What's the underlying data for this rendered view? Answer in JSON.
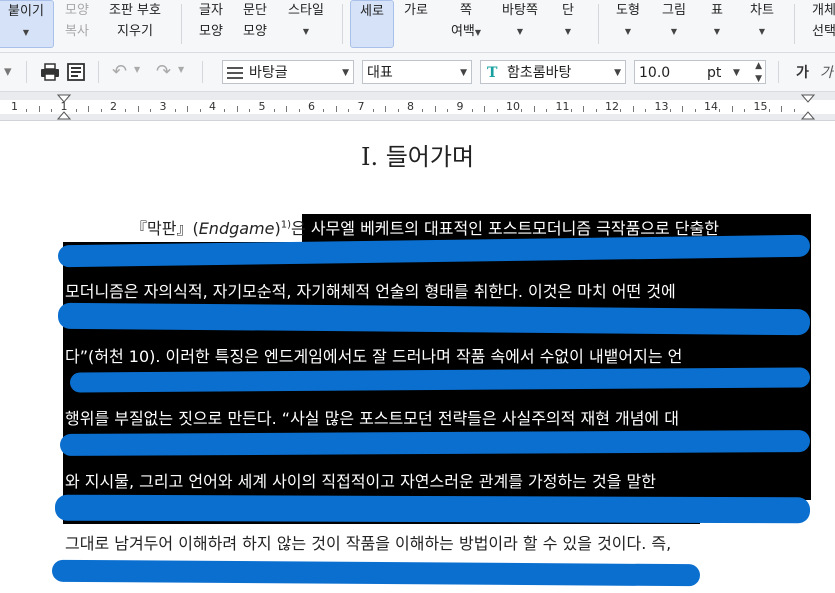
{
  "ribbon": {
    "paste": {
      "label": "붙이기"
    },
    "format_copy": {
      "line1": "모양",
      "line2": "복사"
    },
    "clear_marks": {
      "line1": "조판 부호",
      "line2": "지우기"
    },
    "char_shape": {
      "line1": "글자",
      "line2": "모양"
    },
    "para_shape": {
      "line1": "문단",
      "line2": "모양"
    },
    "style": {
      "label": "스타일"
    },
    "portrait": {
      "label": "세로"
    },
    "landscape": {
      "label": "가로"
    },
    "margins": {
      "line1": "쪽",
      "line2": "여백"
    },
    "page_bg": {
      "label": "바탕쪽"
    },
    "columns": {
      "label": "단"
    },
    "shape": {
      "label": "도형"
    },
    "picture": {
      "label": "그림"
    },
    "table": {
      "label": "표"
    },
    "chart": {
      "label": "차트"
    },
    "object_select": {
      "line1": "개체",
      "line2": "선택"
    }
  },
  "toolbar": {
    "style_value": "바탕글",
    "lang_value": "대표",
    "font_value": "함초롬바탕",
    "size_value": "10.0",
    "size_unit": "pt",
    "bold_label": "가",
    "italic_label": "가"
  },
  "ruler": {
    "labels": [
      "1",
      "1",
      "2",
      "3",
      "4",
      "5",
      "6",
      "7",
      "8",
      "9",
      "10",
      "11",
      "12",
      "13",
      "14",
      "15"
    ]
  },
  "document": {
    "title": "Ⅰ. 들어가며",
    "line1_prefix": "『막판』(",
    "line1_italic": "Endgame",
    "line1_sup": "1)",
    "line1_mid": "은",
    "line1_hl": " 사무엘 베케트의 대표적인 포스트모더니즘 극작품으로 단출한",
    "line3": "모더니즘은 자의식적, 자기모순적, 자기해체적 언술의 형태를 취한다. 이것은 마치 어떤 것에",
    "line5": "다”(허천 10). 이러한 특징은 엔드게임에서도 잘 드러나며 작품 속에서 수없이 내뱉어지는 언",
    "line7": "행위를 부질없는 짓으로 만든다. “사실 많은 포스트모던 전략들은 사실주의적 재현 개념에 대",
    "line9": "와 지시물, 그리고 언어와 세계 사이의 직접적이고 자연스러운 관계를 가정하는 것을 말한",
    "line11": "그대로 남겨두어 이해하려 하지 않는 것이 작품을 이해하는 방법이라 할 수 있을 것이다. 즉,"
  }
}
